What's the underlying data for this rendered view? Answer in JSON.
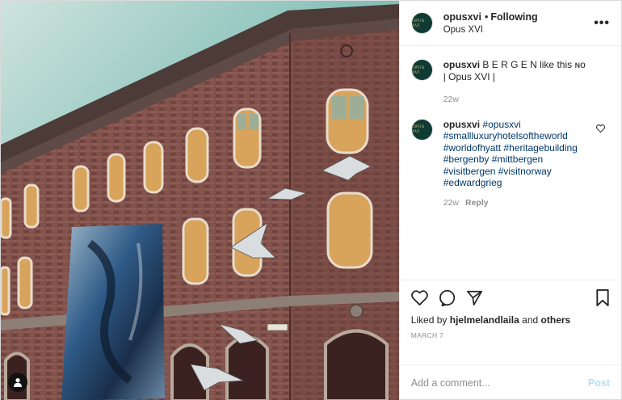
{
  "post": {
    "username": "opusxvi",
    "separator": "•",
    "follow_status": "Following",
    "location": "Opus XVI",
    "more_icon": "more-horizontal-icon",
    "avatar_text": "OPUS XVI"
  },
  "caption": {
    "username": "opusxvi",
    "text": "B E R G E N like this ɴᴏ | Opus XVI |",
    "time": "22w"
  },
  "comment": {
    "username": "opusxvi",
    "hashtags": "#opusxvi #smallluxuryhotelsoftheworld #worldofhyatt #heritagebuilding #bergenby #mittbergen #visitbergen #visitnorway #edwardgrieg",
    "time": "22w",
    "reply_label": "Reply"
  },
  "actions": {
    "icons": [
      "heart-icon",
      "comment-icon",
      "share-icon",
      "save-icon"
    ],
    "liked_prefix": "Liked by",
    "liked_user": "hjelmelandlaila",
    "liked_and": "and",
    "liked_others": "others",
    "date": "MARCH 7"
  },
  "add_comment": {
    "placeholder": "Add a comment...",
    "post_label": "Post"
  },
  "colors": {
    "link": "#00376b",
    "muted": "#8e8e8e",
    "post_button": "#b2dffc",
    "avatar_bg": "#0f3b33"
  }
}
